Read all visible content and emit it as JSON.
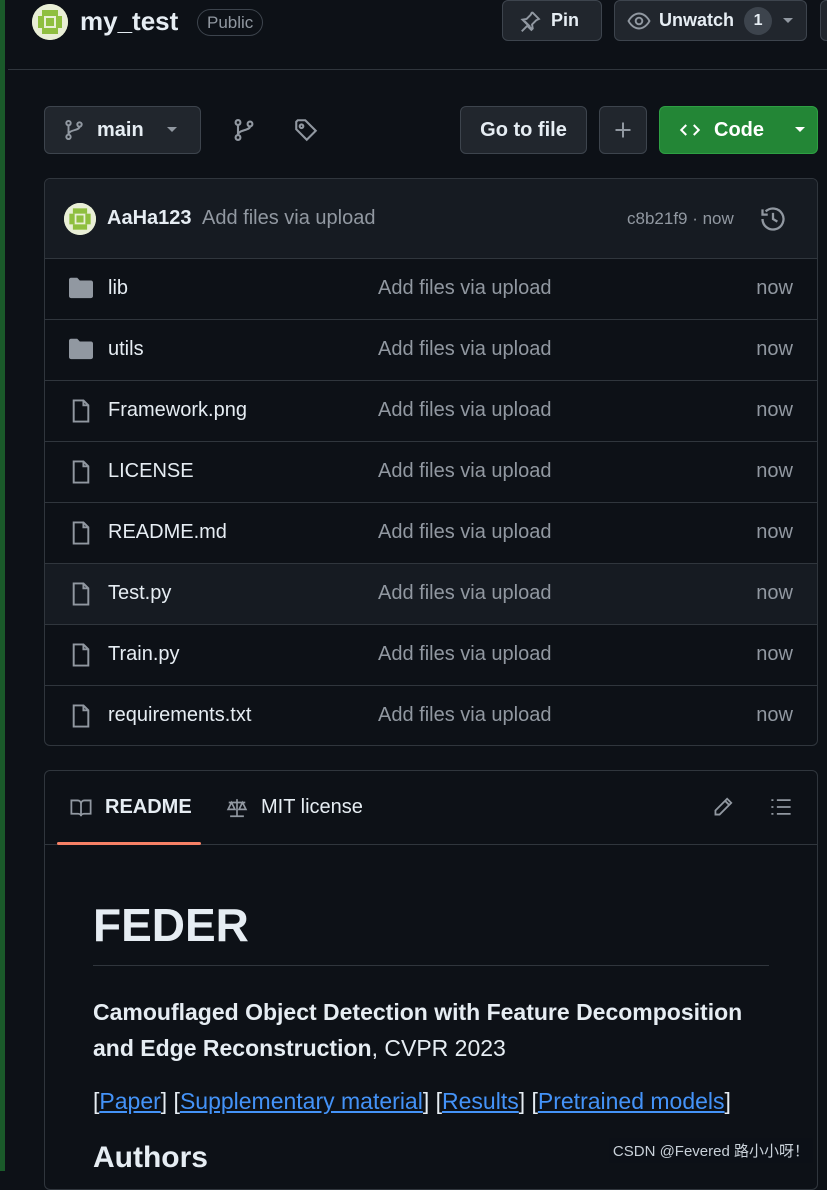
{
  "repo": {
    "name": "my_test",
    "visibility": "Public"
  },
  "header_actions": {
    "pin_label": "Pin",
    "unwatch_label": "Unwatch",
    "watch_count": "1"
  },
  "toolbar": {
    "branch": "main",
    "goto_file": "Go to file",
    "add": "+",
    "code": "Code"
  },
  "latest_commit": {
    "author": "AaHa123",
    "message": "Add files via upload",
    "meta": "c8b21f9 · now"
  },
  "files": [
    {
      "type": "dir",
      "name": "lib",
      "message": "Add files via upload",
      "time": "now"
    },
    {
      "type": "dir",
      "name": "utils",
      "message": "Add files via upload",
      "time": "now"
    },
    {
      "type": "file",
      "name": "Framework.png",
      "message": "Add files via upload",
      "time": "now"
    },
    {
      "type": "file",
      "name": "LICENSE",
      "message": "Add files via upload",
      "time": "now"
    },
    {
      "type": "file",
      "name": "README.md",
      "message": "Add files via upload",
      "time": "now"
    },
    {
      "type": "file",
      "name": "Test.py",
      "message": "Add files via upload",
      "time": "now"
    },
    {
      "type": "file",
      "name": "Train.py",
      "message": "Add files via upload",
      "time": "now"
    },
    {
      "type": "file",
      "name": "requirements.txt",
      "message": "Add files via upload",
      "time": "now"
    }
  ],
  "readme": {
    "tabs": [
      "README",
      "MIT license"
    ],
    "title": "FEDER",
    "paper_title": "Camouflaged Object Detection with Feature Decomposition and Edge Reconstruction",
    "venue": ", CVPR 2023",
    "links": [
      "Paper",
      "Supplementary material",
      "Results",
      "Pretrained models"
    ],
    "next_heading": "Authors"
  },
  "watermark": "CSDN @Fevered 路小小呀！",
  "colors": {
    "background": "#0d1117",
    "border": "#30363d",
    "accent_green": "#238636",
    "link_blue": "#4493f8",
    "tab_underline": "#f78166"
  }
}
